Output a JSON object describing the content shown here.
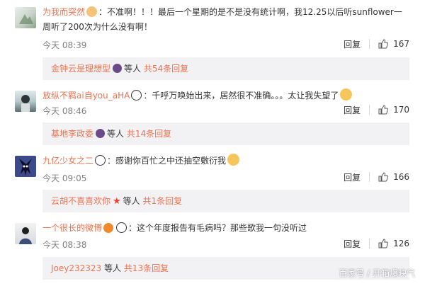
{
  "comments": [
    {
      "username": "为我而突然",
      "text": "：不准啊！！！最后一个星期的是不是没有统计啊，我12.25以后听sunflower一周听了200次为什么没有啊！",
      "time": "今天 08:39",
      "reply_label": "回复",
      "likes": "167",
      "sub": {
        "name": "金钟云是理想型",
        "middle": "等人",
        "more": "共54条回复"
      }
    },
    {
      "username": "放纵不羁ai自you_aHA",
      "text": "：千呼万唤始出来，居然很不准确。。。太让我失望了",
      "time": "今天 08:46",
      "reply_label": "回复",
      "likes": "170",
      "sub": {
        "name": "基地李政委",
        "middle": "等人",
        "more": "共14条回复"
      }
    },
    {
      "username": "九亿少女之二",
      "text": "：感谢你百忙之中还抽空敷衍我",
      "time": "今天 09:05",
      "reply_label": "回复",
      "likes": "166",
      "sub": {
        "name": "云胡不喜喜欢你",
        "middle": "等人",
        "more": "共1条回复"
      }
    },
    {
      "username": "一个很长的微博",
      "text": "：这个年度报告有毛病吗？那些歌我一句没听过",
      "time": "今天 08:38",
      "reply_label": "回复",
      "likes": "126",
      "sub": {
        "name": "Joey232323",
        "middle": "等人",
        "more": "共13条回复"
      }
    }
  ],
  "watermark": "百家号 / 开箱爆映气",
  "colors": {
    "accent": "#eb7350",
    "sub_bg": "#f2f2f5",
    "muted": "#808080"
  }
}
